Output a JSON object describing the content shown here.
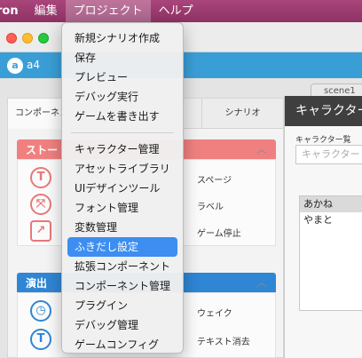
{
  "menubar": {
    "app": "ron",
    "items": [
      "編集",
      "プロジェクト",
      "ヘルプ"
    ],
    "active": "プロジェクト"
  },
  "app_header": {
    "logo": "a",
    "name": "a4"
  },
  "scene_tab": "scene1",
  "left_panel": {
    "tabs": {
      "components": "コンポーネント",
      "scenario": "シナリオ"
    },
    "section_story": {
      "title": "ストー",
      "rows": [
        {
          "icon": "T",
          "icon_name": "text-icon",
          "label": "スページ"
        },
        {
          "icon": "⤧",
          "icon_name": "branch-icon",
          "label": "ラベル"
        },
        {
          "icon": "↗",
          "icon_name": "jump-icon",
          "label": "ゲーム停止"
        }
      ]
    },
    "section_effect": {
      "title": "演出",
      "rows": [
        {
          "icon": "◷",
          "icon_name": "clock-icon",
          "label": "ウェイク"
        },
        {
          "icon": "T",
          "icon_name": "text-clear-icon",
          "label": "テキスト消去"
        }
      ]
    },
    "colors": {
      "story": "#f08080",
      "effect": "#2f86d4"
    }
  },
  "character_panel": {
    "title": "キャラクター",
    "list_label": "キャラクター覧",
    "search_placeholder": "キャラクター",
    "characters": [
      "あかね",
      "やまと"
    ],
    "selected": "あかね"
  },
  "project_menu": {
    "group1": [
      "新規シナリオ作成",
      "保存",
      "プレビュー",
      "デバッグ実行",
      "ゲームを書き出す"
    ],
    "group2": [
      "キャラクター管理",
      "アセットライブラリ",
      "UIデザインツール",
      "フォント管理",
      "変数管理",
      "ふきだし設定",
      "拡張コンポーネント",
      "コンポーネント管理",
      "プラグイン",
      "デバッグ管理",
      "ゲームコンフィグ"
    ],
    "highlighted": "ふきだし設定"
  }
}
